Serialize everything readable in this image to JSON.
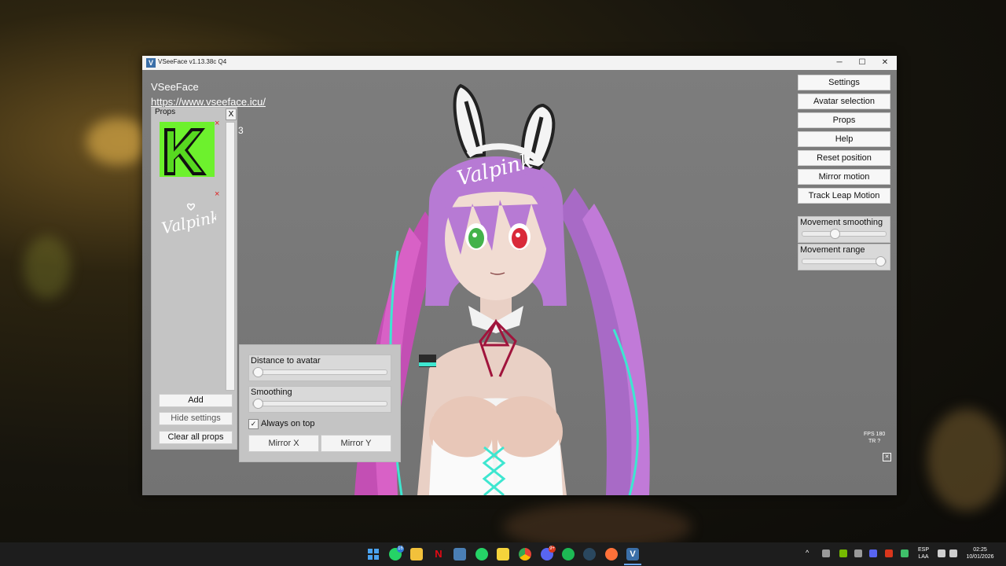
{
  "window": {
    "title": "VSeeFace v1.13.38c Q4",
    "icon_label": "V",
    "controls": {
      "minimize": "─",
      "maximize": "☐",
      "close": "✕"
    }
  },
  "brand": {
    "name": "VSeeFace",
    "link": "https://www.vseeface.icu/"
  },
  "props_panel": {
    "title": "Props",
    "close_label": "X",
    "hidden_text_fragment": "3",
    "items": [
      {
        "icon": "green-k-prop-image"
      },
      {
        "icon": "valpink-logo-prop-image",
        "text": "Valpink"
      }
    ],
    "remove_label": "×",
    "buttons": {
      "add": "Add",
      "hide_settings": "Hide settings",
      "clear_all": "Clear all props"
    }
  },
  "prop_settings": {
    "distance_label": "Distance to avatar",
    "distance_value": 0.0,
    "smoothing_label": "Smoothing",
    "smoothing_value": 0.0,
    "always_on_top_label": "Always on top",
    "always_on_top_checked": true,
    "check_mark": "✓",
    "mirror_x": "Mirror X",
    "mirror_y": "Mirror Y"
  },
  "menu": {
    "buttons": [
      "Settings",
      "Avatar selection",
      "Props",
      "Help",
      "Reset position",
      "Mirror motion",
      "Track Leap Motion"
    ],
    "movement_smoothing_label": "Movement smoothing",
    "movement_smoothing_value": 0.4,
    "movement_range_label": "Movement range",
    "movement_range_value": 0.97
  },
  "status": {
    "fps": "FPS 180",
    "tr": "TR  ?"
  },
  "avatar": {
    "headband_text": "Valpink"
  },
  "taskbar": {
    "apps": [
      "windows-start-icon",
      "whatsapp-icon",
      "file-explorer-icon",
      "netflix-icon",
      "files-icon",
      "whatsapp-desktop-icon",
      "sticky-notes-icon",
      "chrome-icon",
      "discord-icon",
      "spotify-icon",
      "steam-icon",
      "firefox-icon",
      "vseeface-icon"
    ],
    "badges": {
      "whatsapp": "16",
      "discord": "9+"
    },
    "language": "ESP",
    "layout": "LAA",
    "time": "02:25",
    "date": "10/01/2026",
    "colors": {
      "start": "#4aa3f0",
      "whatsapp": "#25d366",
      "explorer": "#f2c13b",
      "netflix": "#e50914",
      "chrome": "#e8b931",
      "discord": "#5865f2",
      "spotify": "#1db954",
      "steam": "#1b2838",
      "firefox": "#ff7139",
      "vseeface": "#3b6fa8"
    }
  }
}
